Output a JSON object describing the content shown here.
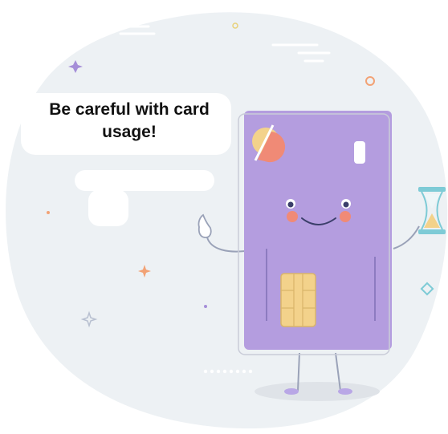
{
  "speech_bubble": {
    "text": "Be careful with card usage!"
  },
  "icons": {
    "card": "credit-card-mascot-icon",
    "chip": "chip-icon",
    "logo": "card-logo-icon",
    "hourglass": "hourglass-icon",
    "hand": "thumbs-up-hand-icon"
  },
  "colors": {
    "background_blob": "#edf1f4",
    "card_fill": "#b49ddf",
    "card_outline": "#8d7bc0",
    "chip": "#f3d28b",
    "cheek": "#f08a76",
    "hourglass_frame": "#7ecbd6",
    "sparkle_orange": "#f2a275",
    "sparkle_purple": "#a58ed8"
  }
}
